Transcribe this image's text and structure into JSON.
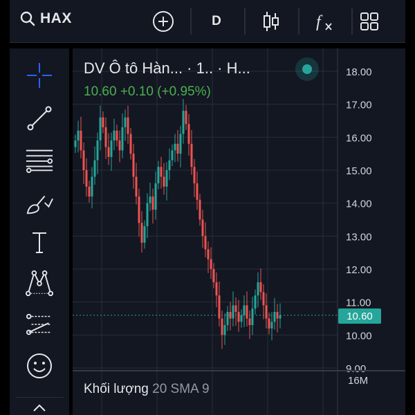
{
  "topbar": {
    "symbol": "HAX",
    "interval": "D",
    "icons": [
      "search-icon",
      "add-circle-icon",
      "candles-icon",
      "indicators-fx-icon",
      "layout-grid-icon"
    ]
  },
  "tools": [
    "crosshair-icon",
    "trendline-icon",
    "fib-lines-icon",
    "brush-icon",
    "text-icon",
    "pattern-icon",
    "measure-icon",
    "emoji-icon"
  ],
  "legend": {
    "title": "DV Ô tô Hàn... · 1.. · H...",
    "price": "10.60",
    "change": "+0.10",
    "change_pct": "(+0.95%)"
  },
  "price_axis": {
    "ticks": [
      "18.00",
      "17.00",
      "16.00",
      "15.00",
      "14.00",
      "13.00",
      "12.00",
      "11.00",
      "10.00",
      "9.00"
    ],
    "last_price": "10.60"
  },
  "volume": {
    "label": "Khối lượng",
    "params": "20 SMA 9",
    "axis_tick": "16M"
  },
  "colors": {
    "up": "#26a69a",
    "down": "#ef5350",
    "background": "#131722",
    "grid": "#2a2e39"
  },
  "chart_data": {
    "type": "candlestick",
    "ylim": [
      9.0,
      18.2
    ],
    "last": 10.6,
    "closes": [
      15.9,
      16.2,
      15.6,
      15.0,
      14.5,
      14.2,
      14.8,
      15.3,
      15.9,
      16.6,
      16.3,
      15.7,
      15.4,
      15.9,
      16.2,
      15.9,
      15.6,
      16.3,
      16.6,
      16.1,
      15.5,
      14.8,
      14.2,
      13.4,
      12.8,
      13.3,
      14.0,
      14.2,
      13.8,
      14.6,
      15.1,
      14.8,
      14.5,
      15.0,
      15.3,
      15.6,
      15.8,
      15.5,
      16.1,
      16.8,
      16.4,
      15.8,
      15.1,
      14.6,
      14.1,
      13.5,
      13.0,
      12.6,
      12.3,
      12.0,
      11.6,
      11.2,
      10.5,
      10.0,
      10.3,
      10.7,
      10.5,
      10.9,
      10.7,
      10.4,
      10.6,
      10.9,
      10.5,
      10.3,
      10.8,
      11.2,
      11.6,
      11.3,
      10.9,
      10.5,
      10.2,
      10.4,
      10.7,
      10.5,
      10.6
    ]
  }
}
